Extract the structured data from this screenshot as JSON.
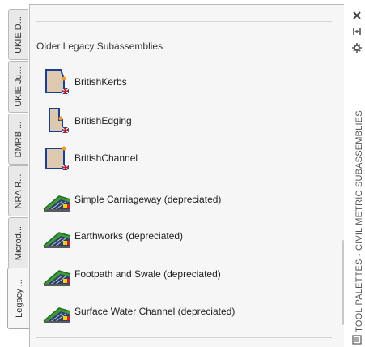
{
  "tabs": [
    {
      "label": "UKIE D..."
    },
    {
      "label": "UKIE Ju..."
    },
    {
      "label": "DMRB ..."
    },
    {
      "label": "NRA R..."
    },
    {
      "label": "Microd..."
    },
    {
      "label": "Legacy ..."
    }
  ],
  "section": {
    "title": "Older Legacy Subassemblies"
  },
  "items": [
    {
      "label": "BritishKerbs",
      "icon": "british-kerb-icon"
    },
    {
      "label": "BritishEdging",
      "icon": "british-edging-icon"
    },
    {
      "label": "BritishChannel",
      "icon": "british-channel-icon"
    },
    {
      "label": "Simple Carriageway (depreciated)",
      "icon": "road-section-icon"
    },
    {
      "label": "Earthworks (depreciated)",
      "icon": "road-section-icon"
    },
    {
      "label": "Footpath and Swale (depreciated)",
      "icon": "road-section-icon"
    },
    {
      "label": "Surface Water Channel (depreciated)",
      "icon": "road-section-icon"
    }
  ],
  "palette": {
    "title": "TOOL PALETTES - CIVIL METRIC SUBASSEMBLIES"
  },
  "controls": {
    "close": "close-icon",
    "autohide": "auto-hide-icon",
    "properties": "properties-icon"
  },
  "colors": {
    "icon_blue": "#1b3f8f",
    "icon_fill": "#ddc9b0",
    "accent_orange": "#f59a23",
    "flag_red": "#cc1f1f"
  }
}
